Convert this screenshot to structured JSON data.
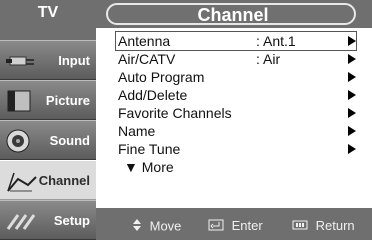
{
  "sidebar": {
    "title": "TV",
    "items": [
      {
        "label": "Input"
      },
      {
        "label": "Picture"
      },
      {
        "label": "Sound"
      },
      {
        "label": "Channel"
      },
      {
        "label": "Setup"
      }
    ]
  },
  "header": {
    "title": "Channel"
  },
  "menu": {
    "items": [
      {
        "label": "Antenna",
        "value": ": Ant.1"
      },
      {
        "label": "Air/CATV",
        "value": ": Air"
      },
      {
        "label": "Auto Program",
        "value": ""
      },
      {
        "label": "Add/Delete",
        "value": ""
      },
      {
        "label": "Favorite Channels",
        "value": ""
      },
      {
        "label": "Name",
        "value": ""
      },
      {
        "label": "Fine Tune",
        "value": ""
      }
    ],
    "more_label": "▼ More"
  },
  "footer": {
    "move_label": "Move",
    "enter_label": "Enter",
    "return_label": "Return",
    "move_icon": "move-arrows-icon",
    "enter_icon": "enter-icon",
    "return_icon": "return-icon"
  },
  "colors": {
    "sidebar_bg": "#6f6f6f",
    "active_item_bg": "#dcdcdc",
    "main_bg": "#ffffff",
    "header_bg": "#6f6f6f"
  }
}
